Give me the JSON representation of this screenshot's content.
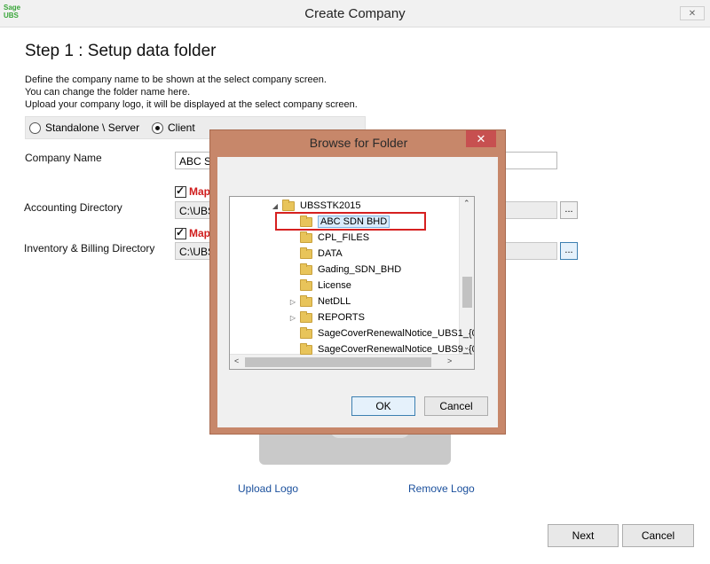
{
  "window": {
    "logo_line1": "Sage",
    "logo_line2": "UBS",
    "title": "Create Company",
    "close_glyph": "✕"
  },
  "step": {
    "title": "Step 1 : Setup data folder",
    "desc1": "Define the company name to be shown at the select company screen.",
    "desc2": "You can change the folder name here.",
    "desc3": "Upload your company logo, it will be displayed at the select company screen."
  },
  "mode": {
    "standalone_label": "Standalone \\ Server",
    "client_label": "Client",
    "selected": "Client"
  },
  "form": {
    "company_name_label": "Company Name",
    "company_name_value": "ABC S",
    "map_label": "Map",
    "accounting_label": "Accounting Directory",
    "accounting_value": "C:\\UBS",
    "inventory_label": "Inventory & Billing Directory",
    "inventory_value": "C:\\UBS",
    "browse_glyph": "..."
  },
  "logo": {
    "upload_label": "Upload Logo",
    "remove_label": "Remove Logo"
  },
  "footer": {
    "next_label": "Next",
    "cancel_label": "Cancel"
  },
  "dialog": {
    "title": "Browse for Folder",
    "close_glyph": "✕",
    "tree": [
      {
        "label": "UBSSTK2015",
        "expander": "◢",
        "indent": 0
      },
      {
        "label": "ABC SDN BHD",
        "expander": "",
        "indent": 1,
        "selected": true
      },
      {
        "label": "CPL_FILES",
        "expander": "",
        "indent": 1
      },
      {
        "label": "DATA",
        "expander": "",
        "indent": 1
      },
      {
        "label": "Gading_SDN_BHD",
        "expander": "",
        "indent": 1
      },
      {
        "label": "License",
        "expander": "",
        "indent": 1
      },
      {
        "label": "NetDLL",
        "expander": "▷",
        "indent": 1
      },
      {
        "label": "REPORTS",
        "expander": "▷",
        "indent": 1
      },
      {
        "label": "SageCoverRenewalNotice_UBS1_{0",
        "expander": "",
        "indent": 1
      },
      {
        "label": "SageCoverRenewalNotice_UBS9_{0",
        "expander": "",
        "indent": 1
      }
    ],
    "ok_label": "OK",
    "cancel_label": "Cancel"
  },
  "colors": {
    "dialog_frame": "#c7876a",
    "highlight": "#d62020",
    "link": "#1a4f9c",
    "map_text": "#d01c1c"
  }
}
